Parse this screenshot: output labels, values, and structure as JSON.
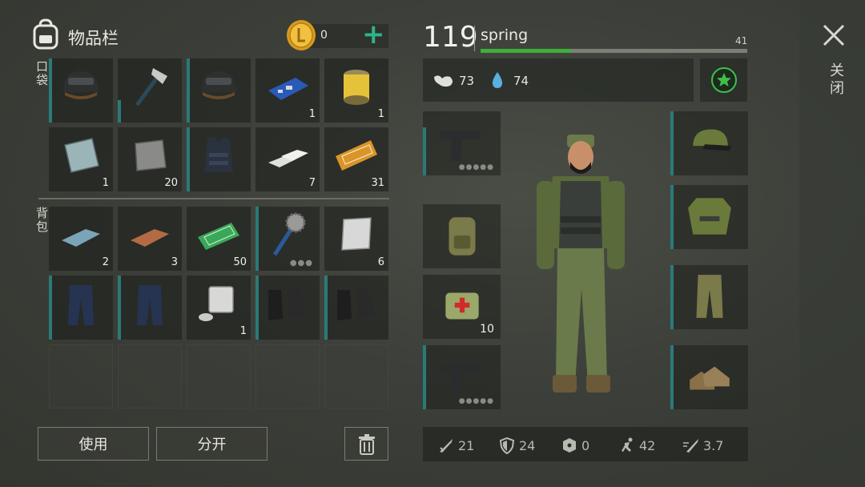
{
  "inventory": {
    "title": "物品栏",
    "coins": "0",
    "pocket_label": "口袋",
    "backpack_label": "背包",
    "pocket_items": [
      {
        "name": "helmet",
        "count": ""
      },
      {
        "name": "hatchet",
        "count": ""
      },
      {
        "name": "helmet",
        "count": ""
      },
      {
        "name": "circuit-board",
        "count": "1"
      },
      {
        "name": "oil-filter",
        "count": "1"
      },
      {
        "name": "metal-plate",
        "count": "1"
      },
      {
        "name": "scrap-metal",
        "count": "20"
      },
      {
        "name": "body-armor",
        "count": ""
      },
      {
        "name": "aluminum-ingots",
        "count": "7"
      },
      {
        "name": "survival-kit-coupon",
        "count": "31"
      }
    ],
    "backpack_items": [
      {
        "name": "iron-ingot",
        "count": "2"
      },
      {
        "name": "copper-ingot",
        "count": "3"
      },
      {
        "name": "ration-coupon",
        "count": "50"
      },
      {
        "name": "saw-mace",
        "count": ""
      },
      {
        "name": "steel-plate",
        "count": "6"
      },
      {
        "name": "tactical-pants",
        "count": ""
      },
      {
        "name": "tactical-pants",
        "count": ""
      },
      {
        "name": "engine-block",
        "count": "1"
      },
      {
        "name": "combat-boots",
        "count": ""
      },
      {
        "name": "combat-boots",
        "count": ""
      }
    ],
    "use_label": "使用",
    "split_label": "分开"
  },
  "player": {
    "level": "119",
    "name": "spring",
    "xp_level_next": "41",
    "xp_progress": 0.34,
    "food": "73",
    "water": "74"
  },
  "equipment": {
    "left": [
      {
        "name": "pistol",
        "count": ""
      },
      {
        "name": "backpack",
        "count": ""
      },
      {
        "name": "medkit-bag",
        "count": "10"
      },
      {
        "name": "pistol-secondary",
        "count": ""
      }
    ],
    "right": [
      {
        "name": "camo-cap",
        "count": ""
      },
      {
        "name": "camo-jacket",
        "count": ""
      },
      {
        "name": "camo-pants",
        "count": ""
      },
      {
        "name": "boots",
        "count": ""
      }
    ]
  },
  "stats": {
    "attack": "21",
    "defense": "24",
    "radiation": "0",
    "speed": "42",
    "attack_speed": "3.7"
  },
  "close_label": "关闭",
  "colors": {
    "accent_teal": "#2b7a77",
    "xp_green": "#3fae3a",
    "plus_green": "#2fb38a"
  }
}
